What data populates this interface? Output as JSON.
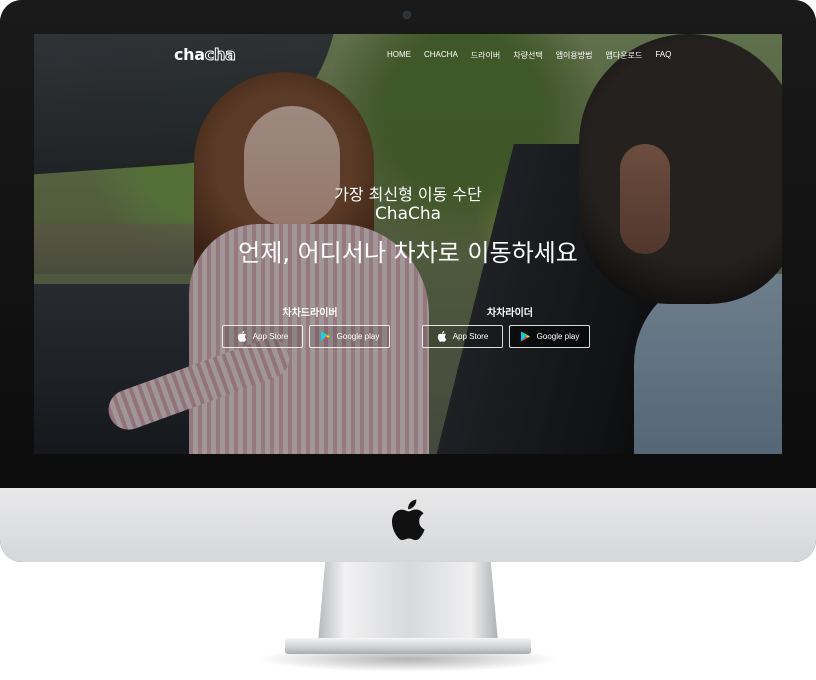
{
  "site": {
    "logo_part1": "cha",
    "logo_part2": "cha"
  },
  "nav": {
    "items": [
      "HOME",
      "CHACHA",
      "드라이버",
      "차량선택",
      "앱이용방법",
      "앱다운로드",
      "FAQ"
    ]
  },
  "hero": {
    "subtitle": "가장 최신형 이동 수단",
    "brand": "ChaCha",
    "title": "언제, 어디서나 차차로 이동하세요"
  },
  "apps": {
    "driver": {
      "title": "차차드라이버",
      "app_store": "App Store",
      "google_play": "Google play"
    },
    "rider": {
      "title": "차차라이더",
      "app_store": "App Store",
      "google_play": "Google play"
    }
  },
  "icons": {
    "apple": "apple-icon",
    "play": "google-play-icon"
  },
  "colors": {
    "bezel": "#111111",
    "chin": "#e0e1e2",
    "text": "#ffffff"
  }
}
